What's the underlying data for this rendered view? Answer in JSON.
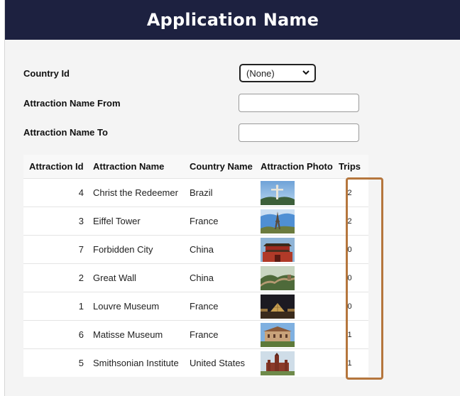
{
  "app": {
    "title": "Application Name"
  },
  "filters": {
    "country_label": "Country Id",
    "country_selected": "(None)",
    "name_from_label": "Attraction Name From",
    "name_from_value": "",
    "name_to_label": "Attraction Name To",
    "name_to_value": ""
  },
  "grid": {
    "columns": [
      "Attraction Id",
      "Attraction Name",
      "Country Name",
      "Attraction Photo",
      "Trips"
    ],
    "rows": [
      {
        "id": "4",
        "name": "Christ the Redeemer",
        "country": "Brazil",
        "photo": "christ-statue-photo",
        "trips": "2"
      },
      {
        "id": "3",
        "name": "Eiffel Tower",
        "country": "France",
        "photo": "eiffel-tower-photo",
        "trips": "2"
      },
      {
        "id": "7",
        "name": "Forbidden City",
        "country": "China",
        "photo": "forbidden-city-photo",
        "trips": "0"
      },
      {
        "id": "2",
        "name": "Great Wall",
        "country": "China",
        "photo": "great-wall-photo",
        "trips": "0"
      },
      {
        "id": "1",
        "name": "Louvre Museum",
        "country": "France",
        "photo": "louvre-photo",
        "trips": "0"
      },
      {
        "id": "6",
        "name": "Matisse Museum",
        "country": "France",
        "photo": "matisse-museum-photo",
        "trips": "1"
      },
      {
        "id": "5",
        "name": "Smithsonian Institute",
        "country": "United States",
        "photo": "smithsonian-photo",
        "trips": "1"
      }
    ]
  },
  "colors": {
    "header_bg": "#1d2140",
    "highlight": "#b5763d"
  }
}
